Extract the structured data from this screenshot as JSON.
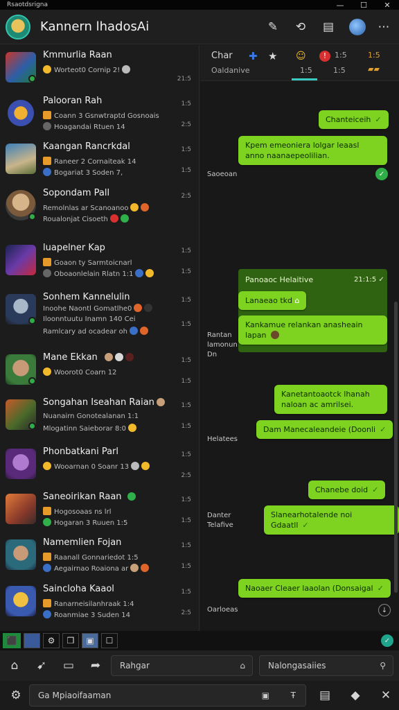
{
  "window": {
    "title": "Rsaotdsrigna",
    "controls": [
      "—",
      "☐",
      "✕"
    ]
  },
  "header": {
    "name": "Kannern lhadosAi"
  },
  "contacts": [
    {
      "name": "Kmmurlia Raan",
      "line2": "Worteot0 Cornip 2!",
      "line3": "",
      "time1": "",
      "time2": "21:5"
    },
    {
      "name": "Palooran Rah",
      "line2": "Coann 3 Gsnwtraptd Gosnoais",
      "line3": "Hoagandai Rtuen 14",
      "time1": "1:5",
      "time2": "2:5"
    },
    {
      "name": "Kaangan Rancrkdal",
      "line2": "Raneer 2 Cornaiteak 14",
      "line3": "Bogariat 3 Soden 7,",
      "time1": "1:5",
      "time2": "1:5"
    },
    {
      "name": "Sopondam Pall",
      "line2": "Remolnlas ar Scanoanoo",
      "line3": "Roualonjat Cisoeth",
      "time1": "2:5",
      "time2": ""
    },
    {
      "name": "luapelner Kap",
      "line2": "Goaon ty Sarmtoicnarl",
      "line3": "Oboaonlelain Rlatn 1:1",
      "time1": "1:5",
      "time2": "1:5"
    },
    {
      "name": "Sonhem Kannelulin",
      "line2": "Inoohe Naontl Gomatlhe0",
      "line3": "Iloonntuutu Inamn 140 Cei",
      "line4": "Ramlcary ad ocadear oh",
      "time1": "1:5",
      "time2": "1:5"
    },
    {
      "name": "Mane Ekkan",
      "line2": "Woorot0 Coarn 12",
      "line3": "",
      "time1": "1:5",
      "time2": "1:5"
    },
    {
      "name": "Songahan Iseahan Raian",
      "line2": "Nuanairn Gonotealanan 1:1",
      "line3": "Mlogatinn Saieborar 8:0",
      "time1": "1:5",
      "time2": "1:5"
    },
    {
      "name": "Phonbatkani Parl",
      "line2": "Wooarnan 0 Soanr 13",
      "line3": "",
      "time1": "1:5",
      "time2": "2:5"
    },
    {
      "name": "Saneoirikan Raan",
      "line2": "Hogosoaas ns lrl",
      "line3": "Hogaran 3 Ruuen 1:5",
      "time1": "1:5",
      "time2": "1:5"
    },
    {
      "name": "Namemlien Fojan",
      "line2": "Raanall Gonnariedot 1:5",
      "line3": "Aegairnao Roaiona ar",
      "time1": "1:5",
      "time2": "1:5"
    },
    {
      "name": "Saincloha Kaaol",
      "line2": "Ranarneisilanhraak 1:4",
      "line3": "Roanmiae 3 Suden 14",
      "time1": "1:5",
      "time2": "2:5"
    }
  ],
  "chat": {
    "tabs": {
      "t1": "Char",
      "t1b": "Oaldanive",
      "n1": "1:5",
      "n2": "1:5",
      "n3": "1:5",
      "n4": "1:5"
    },
    "bubbles": [
      {
        "text": "Chanteiceih",
        "check": "✓"
      },
      {
        "text": "Kpem emeoniera lolgar leaasl anno naanaepeolilian.",
        "check": ""
      },
      {
        "text": "Panoaoc Helaitive",
        "time": "21:1:5",
        "check": "✓"
      },
      {
        "text": "Lanaeao tkd",
        "check": ""
      },
      {
        "text": "Kankamue relankan anasheain lapan",
        "check": ""
      },
      {
        "text": "Kanetantoaotck lhanah naloan ac amrilsei.",
        "check": ""
      },
      {
        "text": "Dam Manecaleandeie (Doonli",
        "check": "✓"
      },
      {
        "text": "Chanebe doid",
        "check": "✓"
      },
      {
        "text": "Slanearhotalende noi Gdaatll",
        "check": "✓"
      },
      {
        "text": "Naoaer Cleaer laaolan (Donsaigal",
        "check": "✓"
      }
    ],
    "senders": {
      "s1": "Saoeoan",
      "s2": "Rantan\nlamonun\nDn",
      "s3": "Helatees",
      "s4": "Danter\nTelafive",
      "s5": "Oarloeas"
    }
  },
  "strip": {
    "items": [
      "⬛",
      "⚙",
      "❒",
      "▣",
      "☐"
    ]
  },
  "bottom": {
    "search1": "Rahgar",
    "search2": "Nalongasaiies",
    "compose": "Ga Mpiaoifaaman"
  }
}
